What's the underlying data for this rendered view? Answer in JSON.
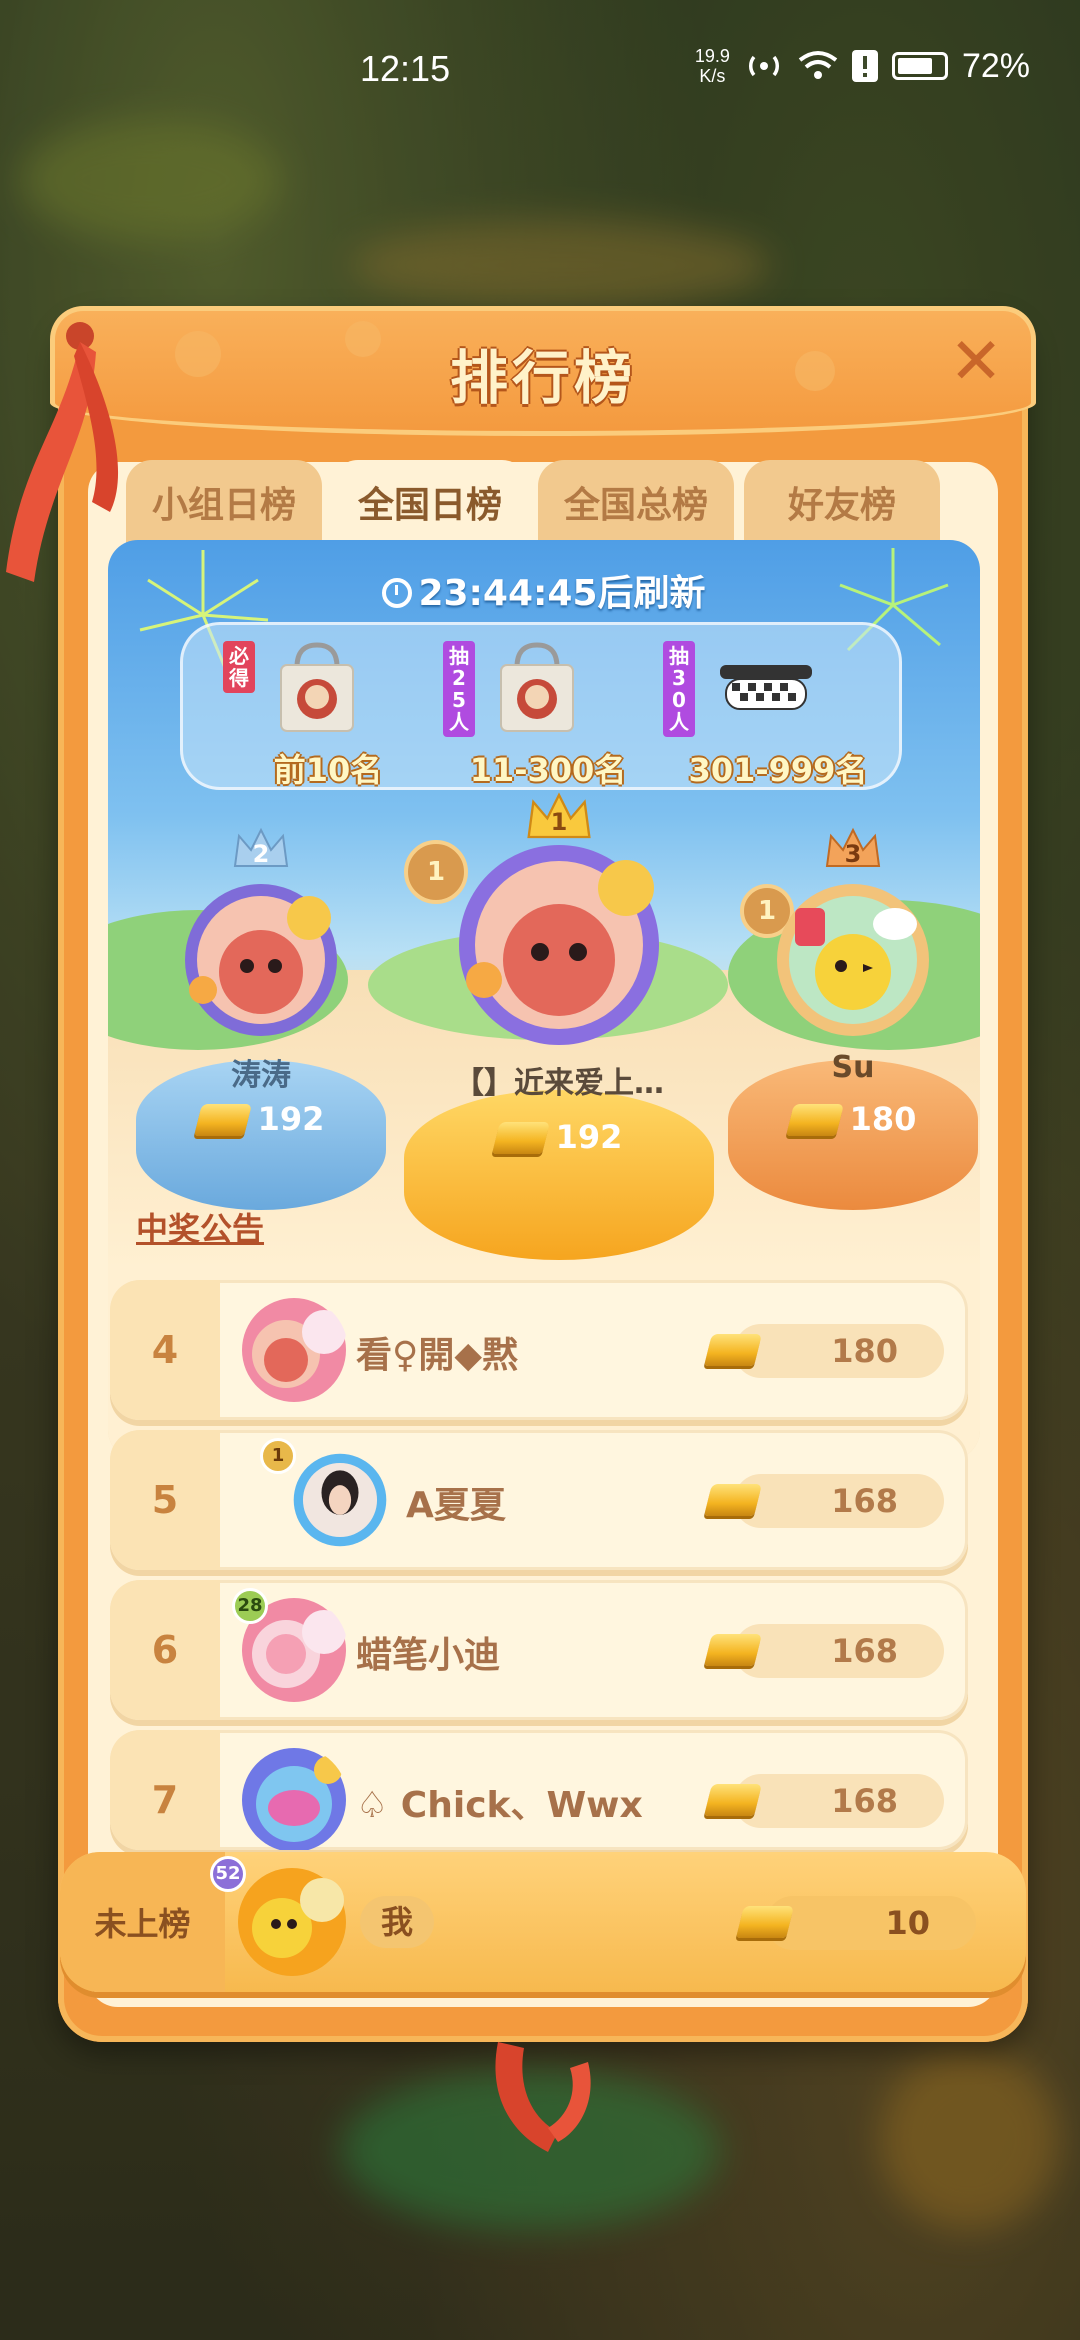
{
  "status_bar": {
    "time": "12:15",
    "net_speed_value": "19.9",
    "net_speed_unit": "K/s",
    "battery": "72%"
  },
  "modal": {
    "title": "排行榜",
    "close_label": "✕"
  },
  "tabs": [
    {
      "label": "小组日榜",
      "active": false
    },
    {
      "label": "全国日榜",
      "active": true
    },
    {
      "label": "全国总榜",
      "active": false
    },
    {
      "label": "好友榜",
      "active": false
    }
  ],
  "refresh": {
    "countdown": "23:44:45",
    "suffix": "后刷新"
  },
  "prizes": [
    {
      "tag": "必得",
      "range": "前10名",
      "tag_color": "#e2445c"
    },
    {
      "tag": "抽25人",
      "range": "11-300名",
      "tag_color": "#b04be0"
    },
    {
      "tag": "抽30人",
      "range": "301-999名",
      "tag_color": "#b04be0"
    }
  ],
  "podium": {
    "first": {
      "name": "【】近来爱上…",
      "score": "192",
      "crown": "1",
      "badge": "1"
    },
    "second": {
      "name": "涛涛",
      "score": "192",
      "crown": "2"
    },
    "third": {
      "name": "Su",
      "score": "180",
      "crown": "3",
      "badge": "1"
    }
  },
  "announcement": "中奖公告",
  "rankings": [
    {
      "rank": "4",
      "name": "看♀開◆黙",
      "score": "180",
      "level": ""
    },
    {
      "rank": "5",
      "name": "A夏夏",
      "score": "168",
      "level": "1"
    },
    {
      "rank": "6",
      "name": "蜡笔小迪",
      "score": "168",
      "level": "28"
    },
    {
      "rank": "7",
      "name": "♤ Chick、Wwx",
      "score": "168",
      "level": ""
    }
  ],
  "me": {
    "rank_label": "未上榜",
    "name": "我",
    "score": "10",
    "level": "52"
  },
  "colors": {
    "accent_orange": "#f39a3e",
    "panel_cream": "#fff2d6",
    "sky_blue": "#4f9ee6",
    "gold": "#f4b421"
  }
}
